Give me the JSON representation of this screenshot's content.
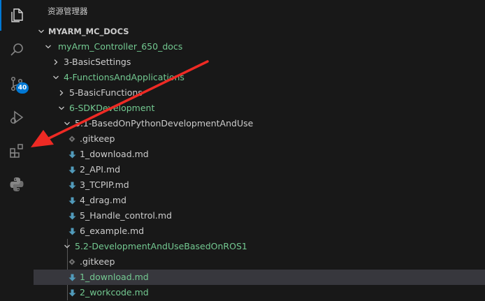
{
  "explorer": {
    "title": "资源管理器",
    "root_label": "MYARM_MC_DOCS"
  },
  "activity": {
    "scm_badge": "40"
  },
  "tree": {
    "myarm": "myArm_Controller_650_docs",
    "basic_settings": "3-BasicSettings",
    "functions": "4-FunctionsAndApplications",
    "basic_functions": "5-BasicFunctions",
    "sdk": "6-SDKDevelopment",
    "python_folder": "5.1-BasedOnPythonDevelopmentAndUse",
    "py_gitkeep": ".gitkeep",
    "py_download": "1_download.md",
    "py_api": "2_API.md",
    "py_tcpip": "3_TCPIP.md",
    "py_drag": "4_drag.md",
    "py_handle": "5_Handle_control.md",
    "py_example": "6_example.md",
    "ros_folder": "5.2-DevelopmentAndUseBasedOnROS1",
    "ros_gitkeep": ".gitkeep",
    "ros_download": "1_download.md",
    "ros_workcode": "2_workcode.md"
  },
  "colors": {
    "modified_green": "#73c991",
    "markdown_icon": "#519aba",
    "selection": "#37373d",
    "accent": "#0078d4",
    "annotation_arrow": "#ee2a24"
  }
}
